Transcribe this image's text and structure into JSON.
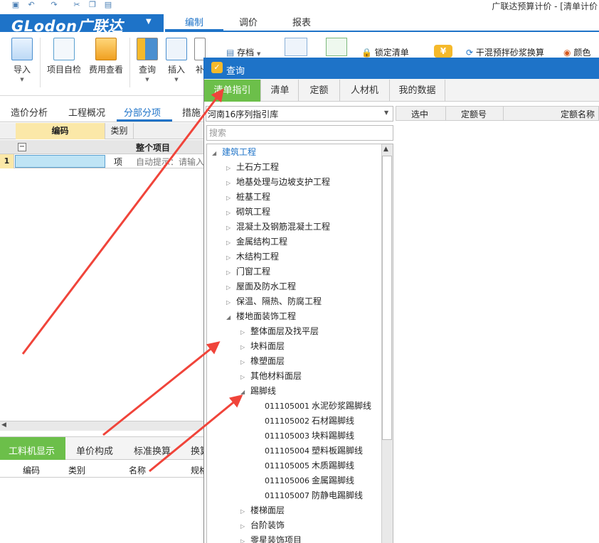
{
  "window": {
    "title": "广联达预算计价 - [清单计价"
  },
  "brand": {
    "logo": "GLodon广联达"
  },
  "menu": {
    "tabs": [
      "编制",
      "调价",
      "报表"
    ]
  },
  "ribbon": {
    "import": "导入",
    "self_check": "项目自检",
    "fee_view": "费用查看",
    "query": "查询",
    "insert": "插入",
    "supplement": "补",
    "save": "存档",
    "lock_list": "锁定清单",
    "dry_mix": "干混预拌砂浆换算",
    "color": "颜色"
  },
  "view_tabs": [
    "造价分析",
    "工程概况",
    "分部分项",
    "措施"
  ],
  "grid": {
    "headers": {
      "code": "编码",
      "type": "类别"
    },
    "rows": [
      {
        "toggle": "−",
        "name": "整个项目"
      },
      {
        "num": "1",
        "type": "项",
        "hint": "自动提示：请输入"
      }
    ]
  },
  "bottom": {
    "tabs": [
      "工料机显示",
      "单价构成",
      "标准换算",
      "换算"
    ],
    "cols": [
      "编码",
      "类别",
      "名称",
      "规格"
    ]
  },
  "dialog": {
    "title": "查询",
    "tabs": [
      "清单指引",
      "清单",
      "定额",
      "人材机",
      "我的数据"
    ],
    "library": "河南16序列指引库",
    "search_placeholder": "搜索",
    "right_cols": [
      "选中",
      "定额号",
      "定额名称"
    ],
    "tree": [
      {
        "level": 0,
        "toggle": "◢",
        "label": "建筑工程"
      },
      {
        "level": 1,
        "toggle": "▷",
        "label": "土石方工程"
      },
      {
        "level": 1,
        "toggle": "▷",
        "label": "地基处理与边坡支护工程"
      },
      {
        "level": 1,
        "toggle": "▷",
        "label": "桩基工程"
      },
      {
        "level": 1,
        "toggle": "▷",
        "label": "砌筑工程"
      },
      {
        "level": 1,
        "toggle": "▷",
        "label": "混凝土及钢筋混凝土工程"
      },
      {
        "level": 1,
        "toggle": "▷",
        "label": "金属结构工程"
      },
      {
        "level": 1,
        "toggle": "▷",
        "label": "木结构工程"
      },
      {
        "level": 1,
        "toggle": "▷",
        "label": "门窗工程"
      },
      {
        "level": 1,
        "toggle": "▷",
        "label": "屋面及防水工程"
      },
      {
        "level": 1,
        "toggle": "▷",
        "label": "保温、隔热、防腐工程"
      },
      {
        "level": 1,
        "toggle": "◢",
        "label": "楼地面装饰工程"
      },
      {
        "level": 2,
        "toggle": "▷",
        "label": "整体面层及找平层"
      },
      {
        "level": 2,
        "toggle": "▷",
        "label": "块料面层"
      },
      {
        "level": 2,
        "toggle": "▷",
        "label": "橡塑面层"
      },
      {
        "level": 2,
        "toggle": "▷",
        "label": "其他材料面层"
      },
      {
        "level": 2,
        "toggle": "◢",
        "label": "踢脚线"
      },
      {
        "level": 3,
        "code": "011105001",
        "label": "水泥砂浆踢脚线"
      },
      {
        "level": 3,
        "code": "011105002",
        "label": "石材踢脚线"
      },
      {
        "level": 3,
        "code": "011105003",
        "label": "块料踢脚线"
      },
      {
        "level": 3,
        "code": "011105004",
        "label": "塑料板踢脚线"
      },
      {
        "level": 3,
        "code": "011105005",
        "label": "木质踢脚线"
      },
      {
        "level": 3,
        "code": "011105006",
        "label": "金属踢脚线"
      },
      {
        "level": 3,
        "code": "011105007",
        "label": "防静电踢脚线"
      },
      {
        "level": 2,
        "toggle": "▷",
        "label": "楼梯面层"
      },
      {
        "level": 2,
        "toggle": "▷",
        "label": "台阶装饰"
      },
      {
        "level": 2,
        "toggle": "▷",
        "label": "零星装饰项目"
      }
    ]
  },
  "colors": {
    "accent_blue": "#1e73c8",
    "active_green": "#6cbf4a",
    "arrow_red": "#f0443a",
    "header_yellow": "#fbe8a8"
  }
}
